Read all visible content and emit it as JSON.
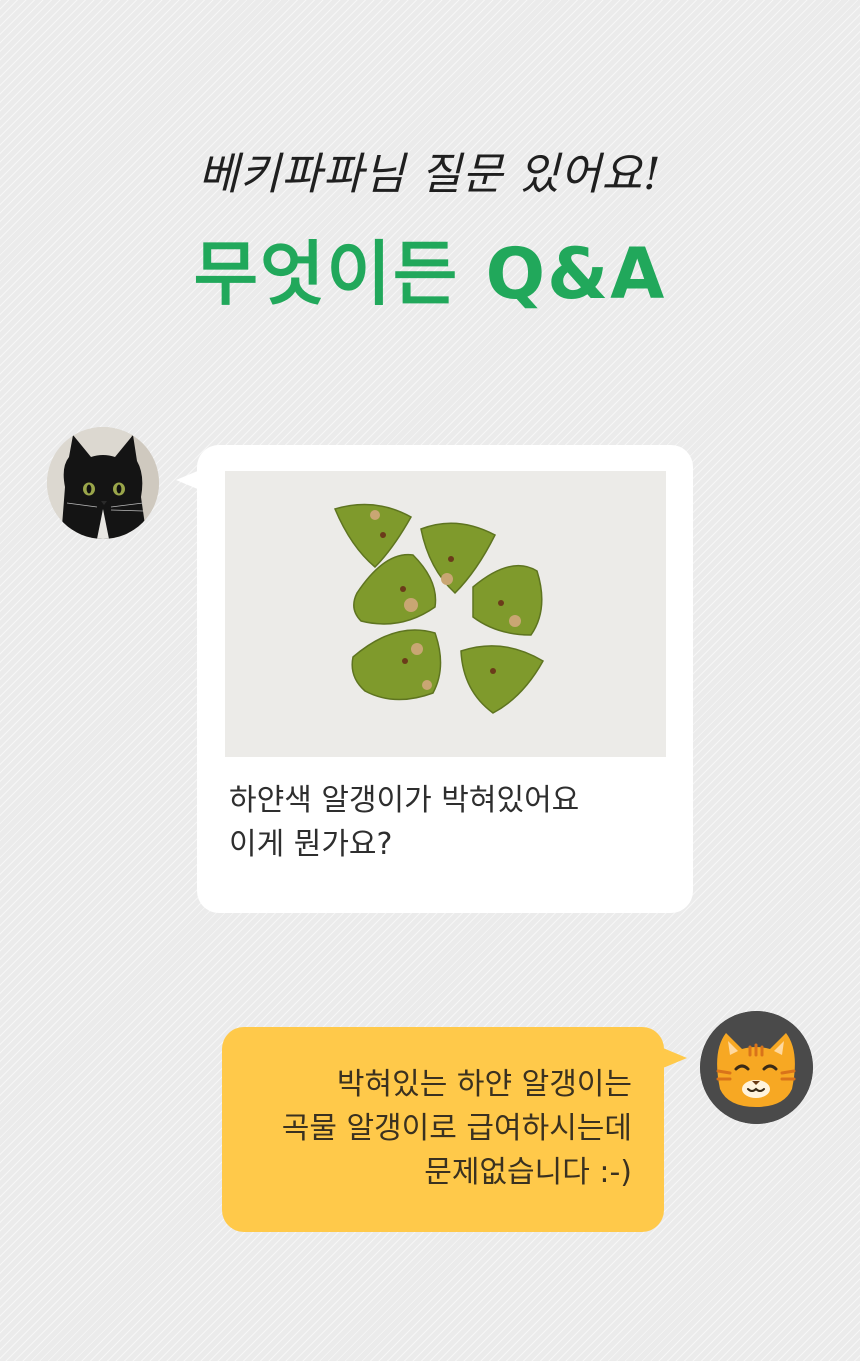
{
  "header": {
    "subtitle": "베키파파님 질문 있어요!",
    "title": "무엇이든 Q&A"
  },
  "question": {
    "avatar_icon": "black-cat-photo",
    "photo": "green-triangle-cat-treats-photo",
    "lines": [
      "하얀색 알갱이가 박혀있어요",
      "이게 뭔가요?"
    ]
  },
  "answer": {
    "avatar_icon": "orange-cat-face-icon",
    "lines": [
      "박혀있는 하얀 알갱이는",
      "곡물 알갱이로 급여하시는데",
      "문제없습니다 :-)"
    ]
  },
  "colors": {
    "title_green": "#21a85b",
    "answer_bubble": "#ffc94a",
    "question_bubble": "#ffffff"
  }
}
